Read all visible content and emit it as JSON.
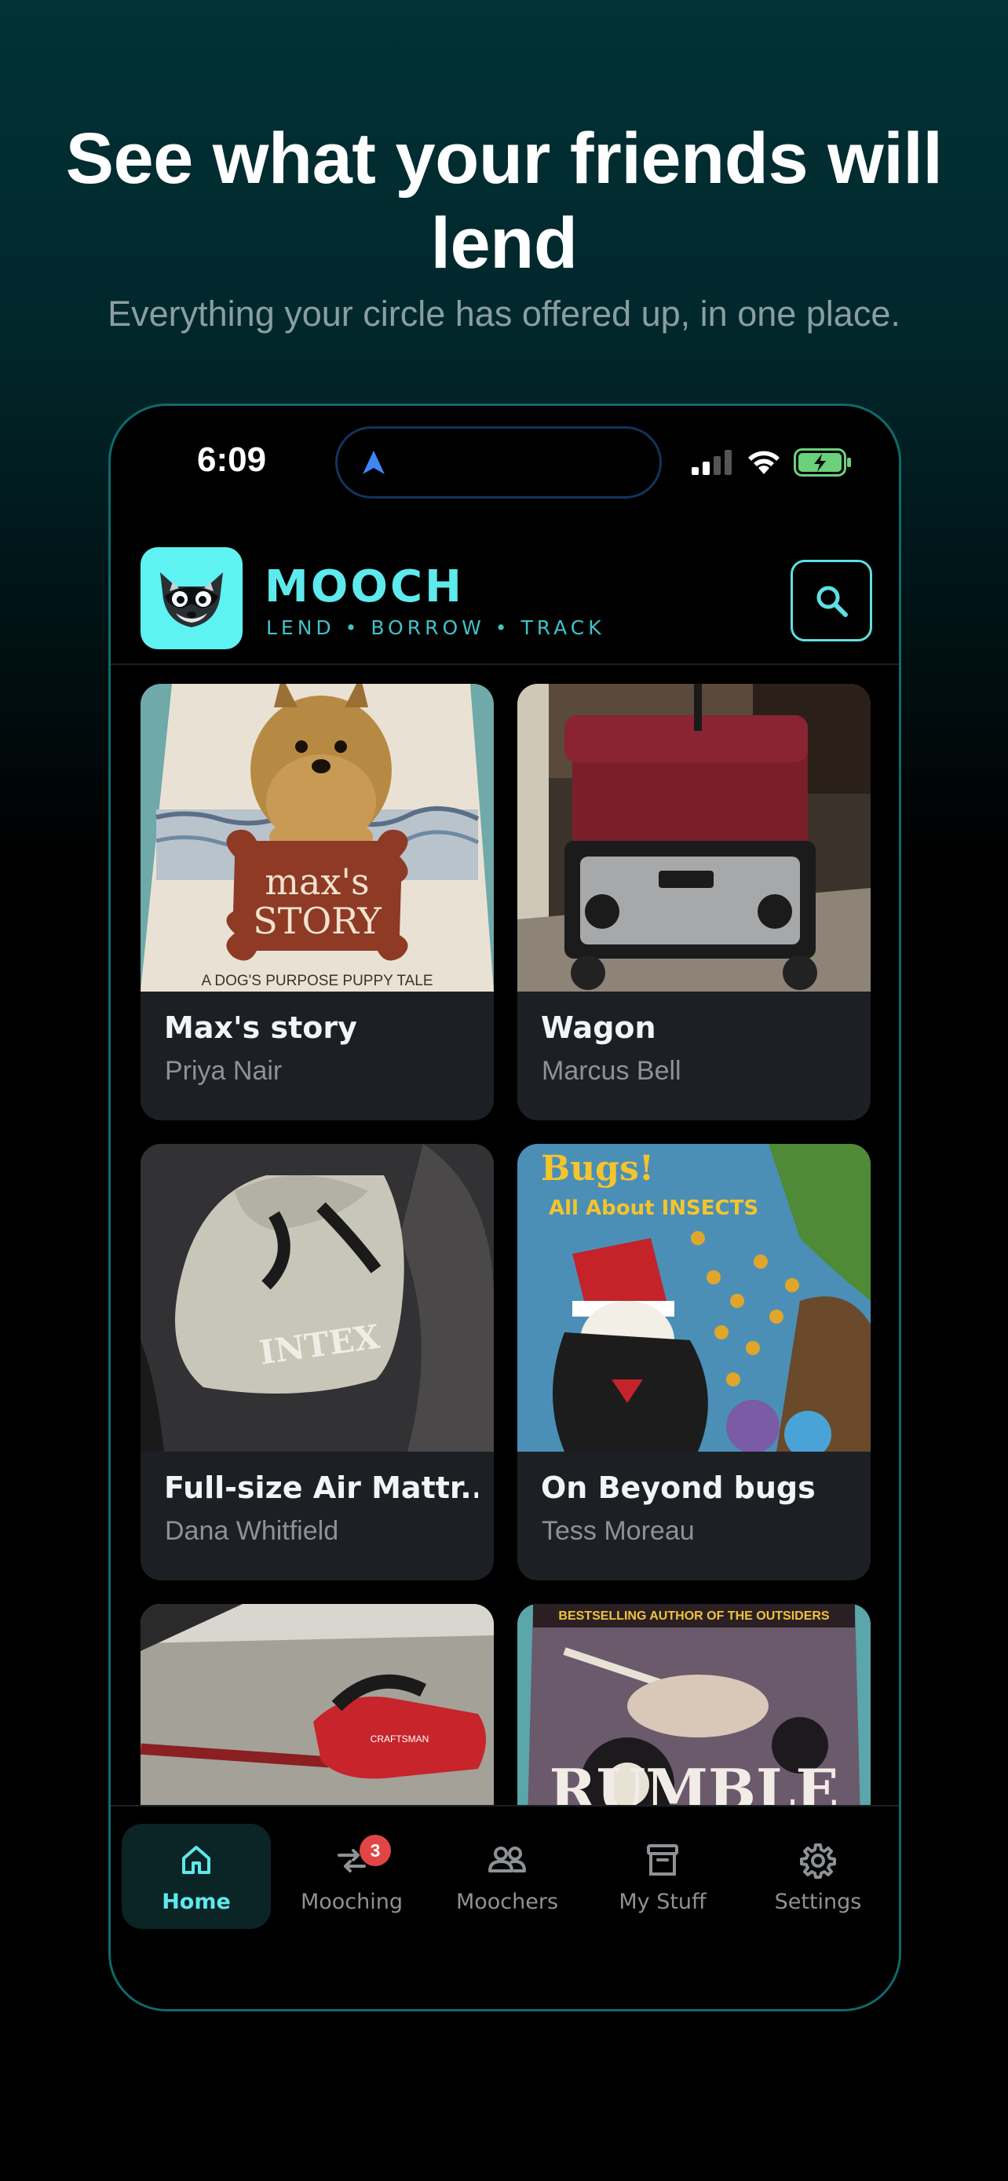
{
  "hero": {
    "title": "See what your friends will lend",
    "subtitle": "Everything your circle has offered up, in one place."
  },
  "status_bar": {
    "time": "6:09",
    "icons": [
      "location-arrow-icon",
      "cellular-signal-icon",
      "wifi-icon",
      "battery-charging-icon"
    ]
  },
  "header": {
    "brand": "MOOCH",
    "tagline": "LEND • BORROW • TRACK",
    "logo_icon": "raccoon-icon",
    "search_icon": "search-icon"
  },
  "items": [
    {
      "title": "Max's story",
      "owner": "Priya Nair"
    },
    {
      "title": "Wagon",
      "owner": "Marcus Bell"
    },
    {
      "title": "Full-size Air Mattr...",
      "owner": "Dana Whitfield"
    },
    {
      "title": "On Beyond bugs",
      "owner": "Tess Moreau"
    },
    {
      "title": "",
      "owner": ""
    },
    {
      "title": "",
      "owner": ""
    }
  ],
  "photo_text": {
    "book1_line1": "max's",
    "book1_line2": "STORY",
    "book1_footer": "A DOG'S PURPOSE PUPPY TALE",
    "book2_title": "Bugs!",
    "book2_subtitle": "All About INSECTS",
    "book3_banner": "BESTSELLING AUTHOR OF THE OUTSIDERS",
    "book3_title": "RUMBLE",
    "bag_text": "INTEX",
    "trimmer_brand": "CRAFTSMAN"
  },
  "tabs": [
    {
      "label": "Home",
      "icon": "home-icon",
      "active": true
    },
    {
      "label": "Mooching",
      "icon": "arrows-exchange-icon",
      "badge": "3"
    },
    {
      "label": "Moochers",
      "icon": "users-icon"
    },
    {
      "label": "My Stuff",
      "icon": "archive-box-icon"
    },
    {
      "label": "Settings",
      "icon": "gear-icon"
    }
  ],
  "colors": {
    "accent": "#5ee9ec",
    "card_bg": "#1c1f23",
    "badge": "#e24545",
    "phone_border": "#0f6a6c"
  }
}
